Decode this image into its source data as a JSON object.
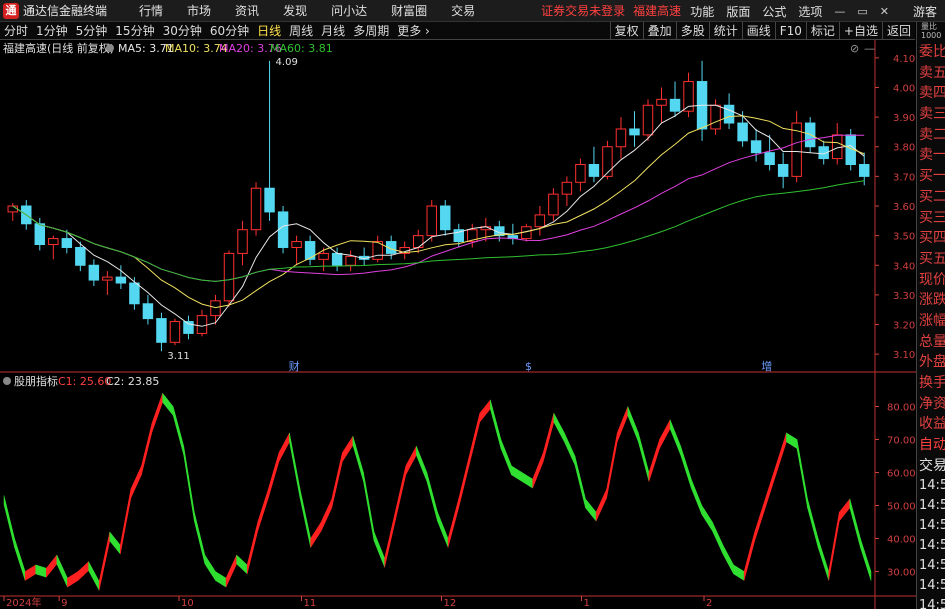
{
  "app": {
    "title": "通达信金融终端",
    "logo": "通"
  },
  "menu": [
    "行情",
    "市场",
    "资讯",
    "发现",
    "问小达",
    "财富圈",
    "交易"
  ],
  "notices": [
    "证券交易未登录",
    "福建高速"
  ],
  "right_menu": [
    "功能",
    "版面",
    "公式",
    "选项"
  ],
  "window_controls": [
    "—",
    "▭",
    "✕"
  ],
  "guest": "游客",
  "periods": [
    "分时",
    "1分钟",
    "5分钟",
    "15分钟",
    "30分钟",
    "60分钟",
    "日线",
    "周线",
    "月线",
    "多周期",
    "更多 ›"
  ],
  "active_period": "日线",
  "toolbar_right": [
    "复权",
    "叠加",
    "多股",
    "统计",
    "画线",
    "F10",
    "标记",
    "+自选",
    "返回"
  ],
  "main_legend": {
    "title": "福建高速(日线 前复权)",
    "ma5": "MA5: 3.71",
    "ma10": "MA10: 3.74",
    "ma20": "MA20: 3.76",
    "ma60": "MA60: 3.81"
  },
  "main_y_ticks": [
    "4.10",
    "4.00",
    "3.90",
    "3.80",
    "3.70",
    "3.60",
    "3.50",
    "3.40",
    "3.30",
    "3.20",
    "3.10"
  ],
  "event_markers": [
    "财",
    "$",
    "增"
  ],
  "price_annotations": {
    "high": "4.09",
    "low": "3.11"
  },
  "sub_legend": {
    "title": "股朋指标",
    "c1": "C1: 25.60",
    "c2": "C2: 23.85"
  },
  "sub_y_ticks": [
    "80.00",
    "70.00",
    "60.00",
    "50.00",
    "40.00",
    "30.00"
  ],
  "x_labels": [
    "2024年",
    "9",
    "10",
    "11",
    "12",
    "1",
    "2"
  ],
  "sidebar": {
    "top": [
      "量比",
      "1000"
    ],
    "items": [
      "委比",
      "卖五",
      "卖四",
      "卖三",
      "卖二",
      "卖一",
      "买一",
      "买二",
      "买三",
      "买四",
      "买五",
      "现价",
      "涨跌",
      "涨幅",
      "总量",
      "外盘",
      "换手",
      "净资",
      "收益"
    ],
    "auto": "自动",
    "trade": "交易",
    "times": [
      "14:56",
      "14:56",
      "14:56",
      "14:56",
      "14:56",
      "14:56",
      "14:56"
    ]
  },
  "colors": {
    "up": "#ff3030",
    "down": "#54d7f0",
    "ma5": "#e8e8e8",
    "ma10": "#f0e060",
    "ma20": "#e040e0",
    "ma60": "#30c030",
    "osc_up": "#ff2020",
    "osc_down": "#30e030",
    "axis": "#c03030",
    "tick": "#d04040"
  },
  "chart_data": [
    {
      "type": "candlestick",
      "title": "福建高速(日线 前复权)",
      "ylim": [
        3.06,
        4.14
      ],
      "ohlc": [
        [
          3.58,
          3.61,
          3.55,
          3.6
        ],
        [
          3.6,
          3.62,
          3.52,
          3.54
        ],
        [
          3.54,
          3.56,
          3.45,
          3.47
        ],
        [
          3.47,
          3.5,
          3.42,
          3.49
        ],
        [
          3.49,
          3.52,
          3.44,
          3.46
        ],
        [
          3.46,
          3.48,
          3.38,
          3.4
        ],
        [
          3.4,
          3.42,
          3.33,
          3.35
        ],
        [
          3.35,
          3.38,
          3.3,
          3.36
        ],
        [
          3.36,
          3.4,
          3.32,
          3.34
        ],
        [
          3.34,
          3.36,
          3.25,
          3.27
        ],
        [
          3.27,
          3.3,
          3.2,
          3.22
        ],
        [
          3.22,
          3.24,
          3.11,
          3.14
        ],
        [
          3.14,
          3.22,
          3.13,
          3.21
        ],
        [
          3.21,
          3.23,
          3.15,
          3.17
        ],
        [
          3.17,
          3.25,
          3.16,
          3.23
        ],
        [
          3.23,
          3.3,
          3.2,
          3.28
        ],
        [
          3.28,
          3.45,
          3.26,
          3.44
        ],
        [
          3.44,
          3.55,
          3.4,
          3.52
        ],
        [
          3.52,
          3.68,
          3.5,
          3.66
        ],
        [
          3.66,
          4.09,
          3.55,
          3.58
        ],
        [
          3.58,
          3.6,
          3.44,
          3.46
        ],
        [
          3.46,
          3.5,
          3.4,
          3.48
        ],
        [
          3.48,
          3.5,
          3.4,
          3.42
        ],
        [
          3.42,
          3.46,
          3.38,
          3.44
        ],
        [
          3.44,
          3.46,
          3.38,
          3.4
        ],
        [
          3.4,
          3.45,
          3.38,
          3.43
        ],
        [
          3.43,
          3.46,
          3.4,
          3.42
        ],
        [
          3.42,
          3.5,
          3.41,
          3.48
        ],
        [
          3.48,
          3.5,
          3.42,
          3.44
        ],
        [
          3.44,
          3.48,
          3.42,
          3.46
        ],
        [
          3.46,
          3.52,
          3.44,
          3.5
        ],
        [
          3.5,
          3.62,
          3.48,
          3.6
        ],
        [
          3.6,
          3.62,
          3.5,
          3.52
        ],
        [
          3.52,
          3.54,
          3.46,
          3.48
        ],
        [
          3.48,
          3.54,
          3.46,
          3.52
        ],
        [
          3.52,
          3.56,
          3.48,
          3.53
        ],
        [
          3.53,
          3.55,
          3.48,
          3.5
        ],
        [
          3.5,
          3.54,
          3.47,
          3.49
        ],
        [
          3.49,
          3.54,
          3.48,
          3.53
        ],
        [
          3.53,
          3.6,
          3.5,
          3.57
        ],
        [
          3.57,
          3.66,
          3.55,
          3.64
        ],
        [
          3.64,
          3.7,
          3.6,
          3.68
        ],
        [
          3.68,
          3.76,
          3.65,
          3.74
        ],
        [
          3.74,
          3.8,
          3.68,
          3.7
        ],
        [
          3.7,
          3.82,
          3.69,
          3.8
        ],
        [
          3.8,
          3.9,
          3.76,
          3.86
        ],
        [
          3.86,
          3.92,
          3.8,
          3.84
        ],
        [
          3.84,
          3.96,
          3.82,
          3.94
        ],
        [
          3.94,
          4.0,
          3.88,
          3.96
        ],
        [
          3.96,
          4.02,
          3.9,
          3.92
        ],
        [
          3.92,
          4.05,
          3.9,
          4.02
        ],
        [
          4.02,
          4.09,
          3.82,
          3.86
        ],
        [
          3.86,
          3.96,
          3.84,
          3.94
        ],
        [
          3.94,
          3.98,
          3.86,
          3.88
        ],
        [
          3.88,
          3.92,
          3.8,
          3.82
        ],
        [
          3.82,
          3.86,
          3.75,
          3.78
        ],
        [
          3.78,
          3.84,
          3.72,
          3.74
        ],
        [
          3.74,
          3.78,
          3.66,
          3.7
        ],
        [
          3.7,
          3.92,
          3.68,
          3.88
        ],
        [
          3.88,
          3.9,
          3.78,
          3.8
        ],
        [
          3.8,
          3.82,
          3.74,
          3.76
        ],
        [
          3.76,
          3.88,
          3.74,
          3.84
        ],
        [
          3.84,
          3.86,
          3.72,
          3.74
        ],
        [
          3.74,
          3.78,
          3.67,
          3.7
        ]
      ],
      "ma5_last": 3.71,
      "ma10_last": 3.74,
      "ma20_last": 3.76,
      "ma60_last": 3.81
    },
    {
      "type": "area",
      "title": "股朋指标",
      "ylim": [
        25,
        85
      ],
      "series": [
        {
          "name": "C1",
          "values": [
            53,
            40,
            30,
            32,
            31,
            35,
            28,
            30,
            33,
            27,
            42,
            38,
            55,
            62,
            75,
            84,
            80,
            68,
            48,
            35,
            30,
            28,
            35,
            32,
            45,
            55,
            66,
            72,
            55,
            40,
            45,
            52,
            66,
            71,
            60,
            42,
            34,
            48,
            62,
            68,
            60,
            48,
            40,
            52,
            65,
            78,
            82,
            70,
            62,
            60,
            58,
            66,
            78,
            72,
            65,
            52,
            48,
            55,
            72,
            80,
            72,
            60,
            70,
            76,
            68,
            58,
            50,
            45,
            38,
            32,
            30,
            42,
            52,
            62,
            72,
            70,
            52,
            40,
            30,
            48,
            52,
            40,
            30
          ]
        },
        {
          "name": "C2",
          "values": [
            50,
            38,
            32,
            34,
            33,
            34,
            30,
            31,
            32,
            29,
            40,
            40,
            52,
            60,
            72,
            80,
            78,
            70,
            52,
            38,
            32,
            30,
            34,
            33,
            43,
            52,
            63,
            70,
            58,
            43,
            44,
            50,
            63,
            69,
            62,
            45,
            36,
            46,
            59,
            66,
            62,
            50,
            42,
            50,
            62,
            75,
            80,
            72,
            64,
            61,
            59,
            64,
            75,
            73,
            66,
            55,
            50,
            53,
            69,
            77,
            73,
            62,
            68,
            73,
            69,
            60,
            52,
            47,
            40,
            34,
            32,
            40,
            50,
            59,
            69,
            70,
            55,
            43,
            33,
            46,
            50,
            42,
            32
          ]
        }
      ],
      "c1_last": 25.6,
      "c2_last": 23.85
    }
  ]
}
